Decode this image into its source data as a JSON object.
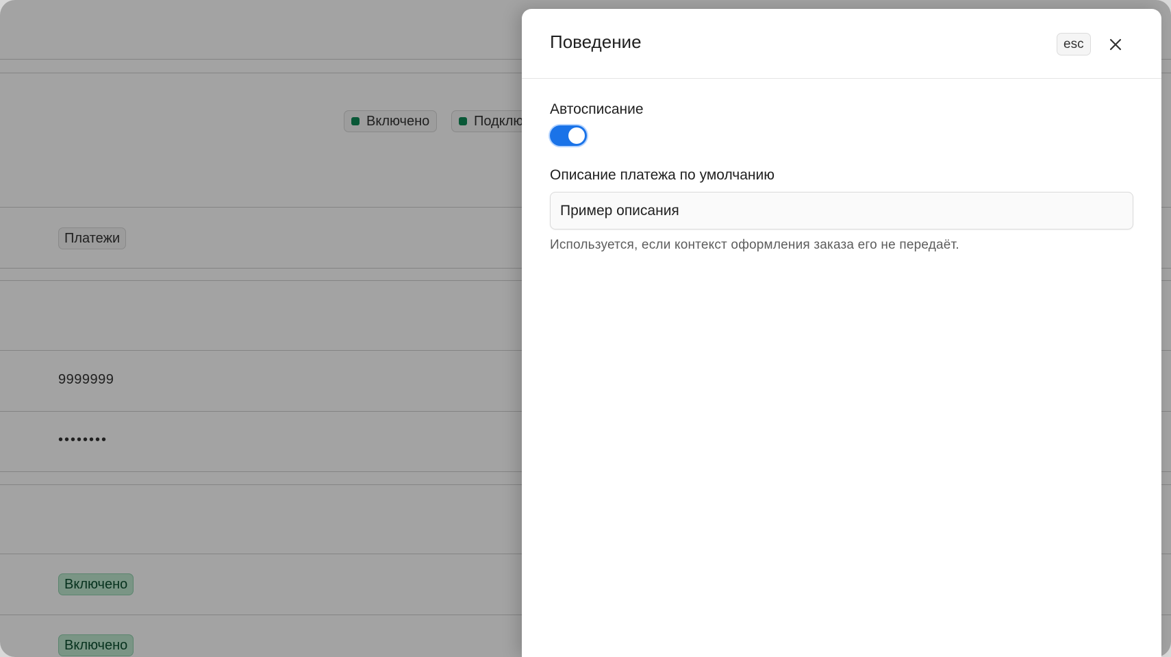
{
  "background": {
    "badges": [
      "Включено",
      "Подклю"
    ],
    "tag_payments": "Платежи",
    "number_value": "9999999",
    "masked_value": "••••••••",
    "status_1": "Включено",
    "status_2": "Включено"
  },
  "drawer": {
    "title": "Поведение",
    "esc_label": "esc",
    "autocharge_label": "Автосписание",
    "autocharge_enabled": true,
    "description_label": "Описание платежа по умолчанию",
    "description_value": "Пример описания",
    "description_hint": "Используется, если контекст оформления заказа его не передаёт."
  },
  "colors": {
    "accent": "#1a73e8",
    "status_green": "#0f8a57"
  }
}
